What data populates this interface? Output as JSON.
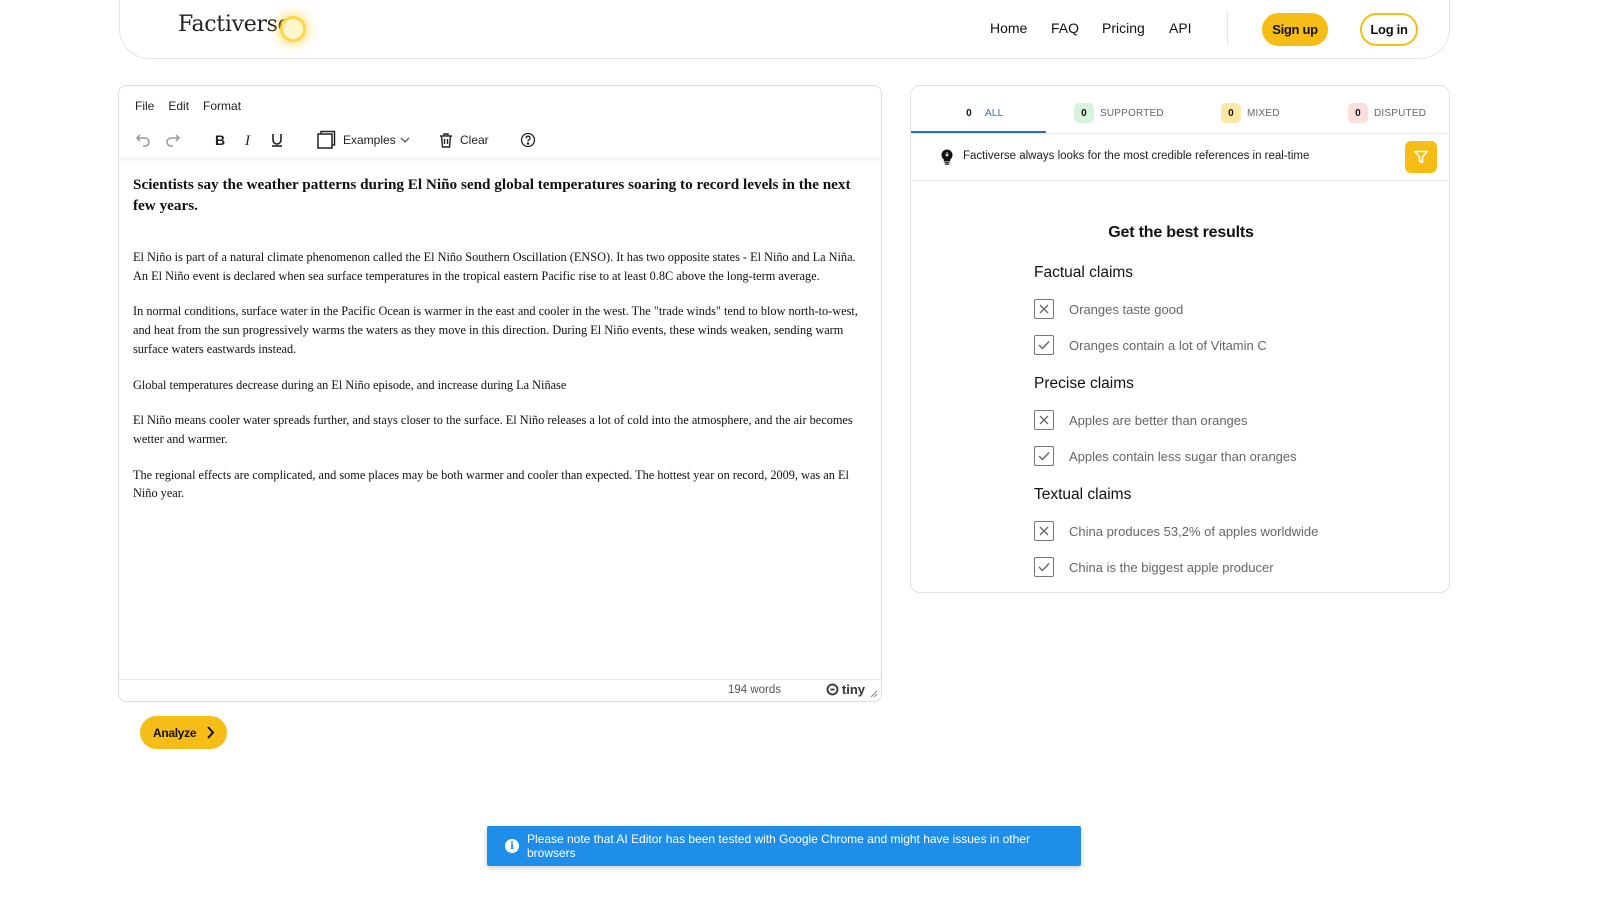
{
  "header": {
    "logo": "Factiverse",
    "nav": [
      "Home",
      "FAQ",
      "Pricing",
      "API"
    ],
    "signup_label": "Sign up",
    "login_label": "Log in"
  },
  "editor": {
    "menu": [
      "File",
      "Edit",
      "Format"
    ],
    "toolbar": {
      "examples_label": "Examples",
      "clear_label": "Clear"
    },
    "heading": "Scientists say the weather patterns during El Niño send global temperatures soaring to record levels in the next few years.",
    "paragraphs": [
      "El Niño is part of a natural climate phenomenon called the El Niño Southern Oscillation (ENSO). It has two opposite states - El Niño and La Niña. An El Niño event is declared when sea surface temperatures in the tropical eastern Pacific rise to at least 0.8C above the long-term average.",
      "In normal conditions, surface water in the Pacific Ocean is warmer in the east and cooler in the west. The \"trade winds\" tend to blow north-to-west, and heat from the sun progressively warms the waters as they move in this direction. During El Niño events, these winds weaken, sending warm surface waters eastwards instead.",
      "Global temperatures decrease during an El Niño episode, and increase during La Niñase",
      "El Niño means cooler water spreads further, and stays closer to the surface. El Niño releases a lot of cold into the atmosphere, and the air becomes wetter and warmer.",
      "The regional effects are complicated, and some places may be both warmer and cooler than expected. The hottest year on record, 2009, was an El Niño year."
    ],
    "word_count": "194 words",
    "brand": "tiny"
  },
  "analyze_label": "Analyze",
  "panel": {
    "tabs": [
      {
        "count": "0",
        "label": "ALL",
        "badge_color": "#ffffff",
        "label_color": "#2c6fbf"
      },
      {
        "count": "0",
        "label": "SUPPORTED",
        "badge_color": "#d8f3dc",
        "label_color": "#666666"
      },
      {
        "count": "0",
        "label": "MIXED",
        "badge_color": "#fde8a6",
        "label_color": "#666666"
      },
      {
        "count": "0",
        "label": "DISPUTED",
        "badge_color": "#fde0db",
        "label_color": "#666666"
      }
    ],
    "info_text": "Factiverse always looks for the most credible references in real-time",
    "best_title": "Get the best results",
    "categories": [
      {
        "title": "Factual claims",
        "claims": [
          {
            "text": "Oranges taste good",
            "mark": "x"
          },
          {
            "text": "Oranges contain a lot of Vitamin C",
            "mark": "check"
          }
        ]
      },
      {
        "title": "Precise claims",
        "claims": [
          {
            "text": "Apples are better than oranges",
            "mark": "x"
          },
          {
            "text": "Apples contain less sugar than oranges",
            "mark": "check"
          }
        ]
      },
      {
        "title": "Textual claims",
        "claims": [
          {
            "text": "China produces 53,2% of apples worldwide",
            "mark": "x"
          },
          {
            "text": "China is the biggest apple producer",
            "mark": "check"
          }
        ]
      }
    ]
  },
  "toast": {
    "text": "Please note that AI Editor has been tested with Google Chrome and might have issues in other browsers"
  },
  "colors": {
    "accent": "#f5bd16",
    "tab_active": "#2c6fbf",
    "toast": "#1f8ee8"
  }
}
